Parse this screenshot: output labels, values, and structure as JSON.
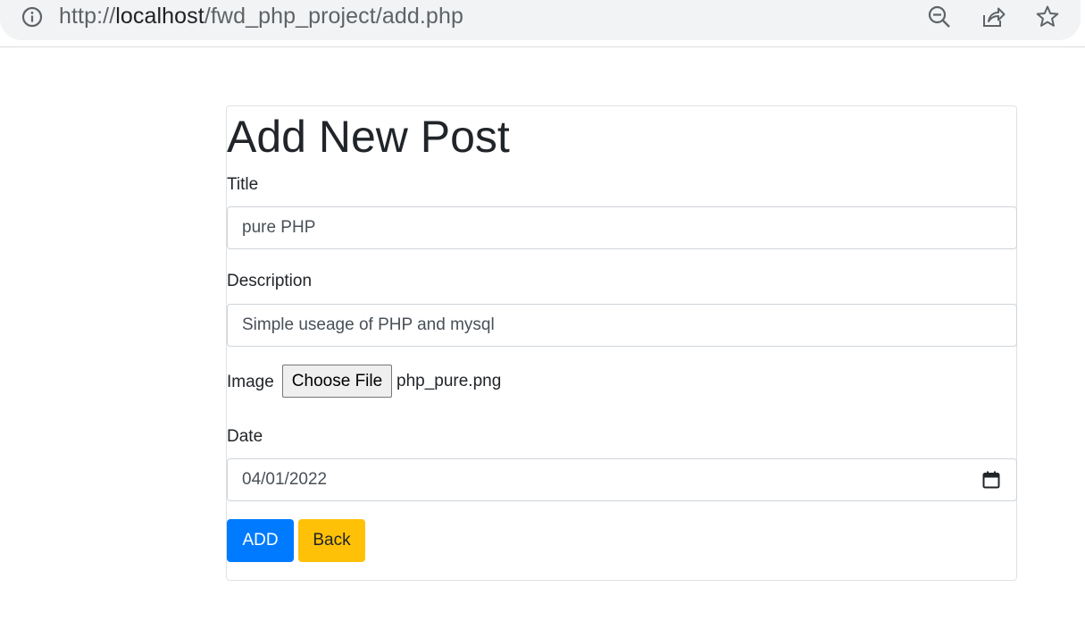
{
  "browser": {
    "url_scheme": "http://",
    "url_host": "localhost",
    "url_path": "/fwd_php_project/add.php",
    "icons": [
      "info-icon",
      "zoom-out-icon",
      "share-icon",
      "bookmark-star-icon"
    ]
  },
  "form": {
    "heading": "Add New Post",
    "title_label": "Title",
    "title_value": "pure PHP",
    "description_label": "Description",
    "description_value": "Simple useage of PHP and mysql",
    "image_label": "Image",
    "choose_file_label": "Choose File",
    "file_name": "php_pure.png",
    "date_label": "Date",
    "date_value": "04/01/2022",
    "add_button": "ADD",
    "back_button": "Back"
  },
  "colors": {
    "primary": "#007bff",
    "warning": "#ffc107",
    "text": "#212529"
  }
}
